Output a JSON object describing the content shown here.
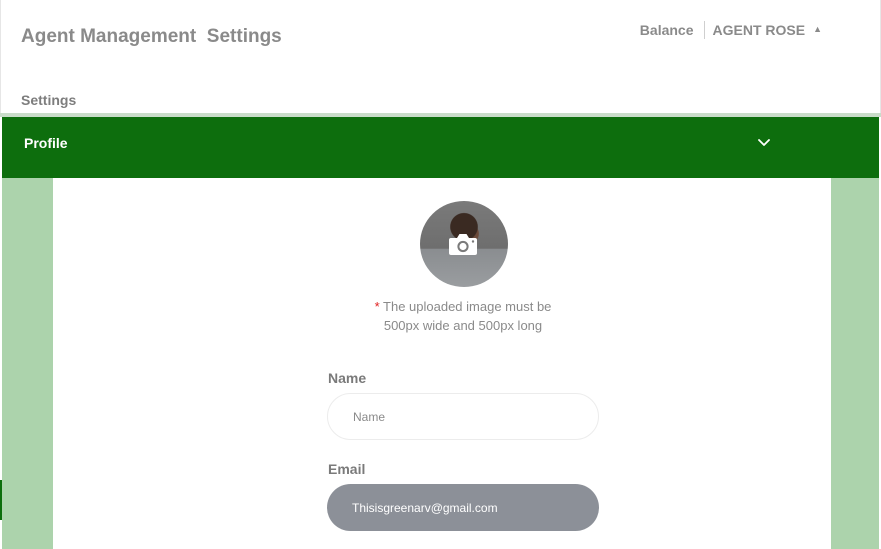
{
  "header": {
    "title": "Agent Management  Settings",
    "balance_label": "Balance",
    "user_name": "AGENT ROSE",
    "user_caret": "▲"
  },
  "breadcrumb": {
    "settings_label": "Settings"
  },
  "profile_section": {
    "title": "Profile",
    "expand_icon": "chevron-down-icon",
    "upload_icon": "camera-icon",
    "image_note": {
      "required_mark": "*",
      "text": " The uploaded image must be 500px wide and 500px long"
    },
    "name_field": {
      "label": "Name",
      "placeholder": "Name",
      "value": ""
    },
    "email_field": {
      "label": "Email",
      "value": "Thisisgreenarv@gmail.com"
    }
  },
  "colors": {
    "accent_green": "#0d6e0d",
    "side_green": "#acd3ac",
    "email_fill": "#8c9098",
    "required_red": "#e02020"
  }
}
